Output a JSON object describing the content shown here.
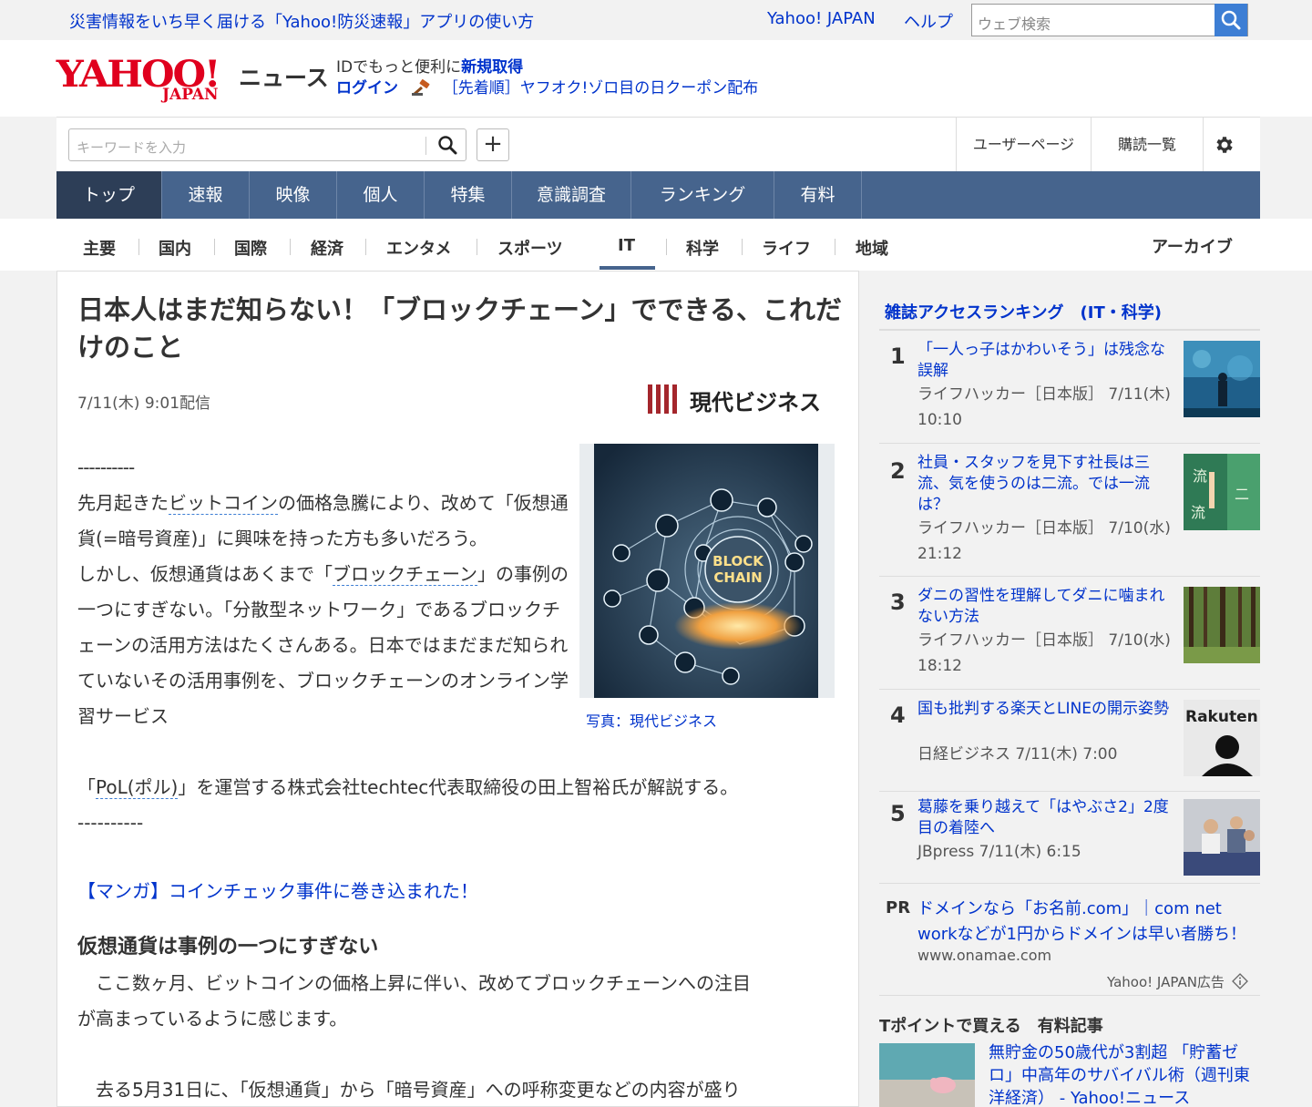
{
  "topbar": {
    "promo": "災害情報をいち早く届ける「Yahoo!防災速報」アプリの使い方",
    "yahoo_japan": "Yahoo! JAPAN",
    "help": "ヘルプ",
    "search_placeholder": "ウェブ検索"
  },
  "header": {
    "logo_main": "YAHOO!",
    "logo_sub": "JAPAN",
    "logo_news": "ニュース",
    "line1_prefix": "IDでもっと便利に",
    "line1_link": "新規取得",
    "login": "ログイン",
    "auction_link": "［先着順］ヤフオク!ゾロ目の日クーポン配布"
  },
  "search_row": {
    "keyword_placeholder": "キーワードを入力",
    "plus": "+",
    "user_page": "ユーザーページ",
    "subscriptions": "購読一覧"
  },
  "nav": {
    "tabs": [
      "トップ",
      "速報",
      "映像",
      "個人",
      "特集",
      "意識調査",
      "ランキング",
      "有料"
    ],
    "active": "トップ"
  },
  "categories": {
    "items": [
      "主要",
      "国内",
      "国際",
      "経済",
      "エンタメ",
      "スポーツ",
      "IT",
      "科学",
      "ライフ",
      "地域"
    ],
    "selected": "IT",
    "archive": "アーカイブ"
  },
  "article": {
    "title": "日本人はまだ知らない！「ブロックチェーン」でできる、これだけのこと",
    "date": "7/11(木) 9:01配信",
    "source": "現代ビジネス",
    "dash1": "----------",
    "p1_a": "先月起きた",
    "p1_link": "ビットコイン",
    "p1_b": "の価格急騰により、改めて「仮想通貨(=暗号資産)」に興味を持った方も多いだろう。",
    "p2_a": "しかし、仮想通貨はあくまで「",
    "p2_link": "ブロックチェーン",
    "p2_b": "」の事例の一つにすぎない。「分散型ネットワーク」であるブロックチェーンの活用方法はたくさんある。日本ではまだまだ知られていないその活用事例を、ブロックチェーンのオンライン学習サービス",
    "p3_a": "「",
    "p3_link": "PoL(ポル)",
    "p3_b": "」を運営する株式会社techtec代表取締役の田上智裕氏が解説する。",
    "dash2": "----------",
    "photo_text1": "BLOCK",
    "photo_text2": "CHAIN",
    "caption": "写真：現代ビジネス",
    "manga_link": "【マンガ】コインチェック事件に巻き込まれた！",
    "subhead": "仮想通貨は事例の一つにすぎない",
    "para_a1": "　ここ数ヶ月、ビットコインの価格上昇に伴い、改めてブロックチェーンへの注目",
    "para_a2": "が高まっているように感じます。",
    "para_b1": "　去る5月31日に、「仮想通貨」から「暗号資産」への呼称変更などの内容が盛り"
  },
  "sidebar": {
    "ranking_title": "雑誌アクセスランキング　(IT・科学)",
    "items": [
      {
        "rank": "1",
        "title": "「一人っ子はかわいそう」は残念な誤解",
        "meta": "ライフハッカー［日本版］ 7/11(木) 10:10"
      },
      {
        "rank": "2",
        "title": "社員・スタッフを見下す社長は三流、気を使うのは二流。では一流は？",
        "meta": "ライフハッカー［日本版］ 7/10(水) 21:12"
      },
      {
        "rank": "3",
        "title": "ダニの習性を理解してダニに噛まれない方法",
        "meta": "ライフハッカー［日本版］ 7/10(水) 18:12"
      },
      {
        "rank": "4",
        "title": "国も批判する楽天とLINEの開示姿勢",
        "meta": "日経ビジネス 7/11(木) 7:00"
      },
      {
        "rank": "5",
        "title": "葛藤を乗り越えて「はやぶさ2」2度目の着陸へ",
        "meta": "JBpress 7/11(木) 6:15"
      }
    ],
    "thumb4_text": "Rakuten",
    "pr_tag": "PR",
    "pr_text": "ドメインなら「お名前.com」｜com net workなどが1円からドメインは早い者勝ち！",
    "pr_url": "www.onamae.com",
    "pr_ad": "Yahoo! JAPAN広告",
    "tpoint_title": "Tポイントで買える　有料記事",
    "tpoint_article": "無貯金の50歳代が3割超 「貯蓄ゼロ」中高年のサバイバル術（週刊東洋経済） - Yahoo!ニュース"
  },
  "colors": {
    "nav_bg": "#46648d",
    "nav_active": "#2d3e57",
    "link": "#0033cc",
    "logo_red": "#e0001e",
    "source_red": "#a4262c"
  }
}
